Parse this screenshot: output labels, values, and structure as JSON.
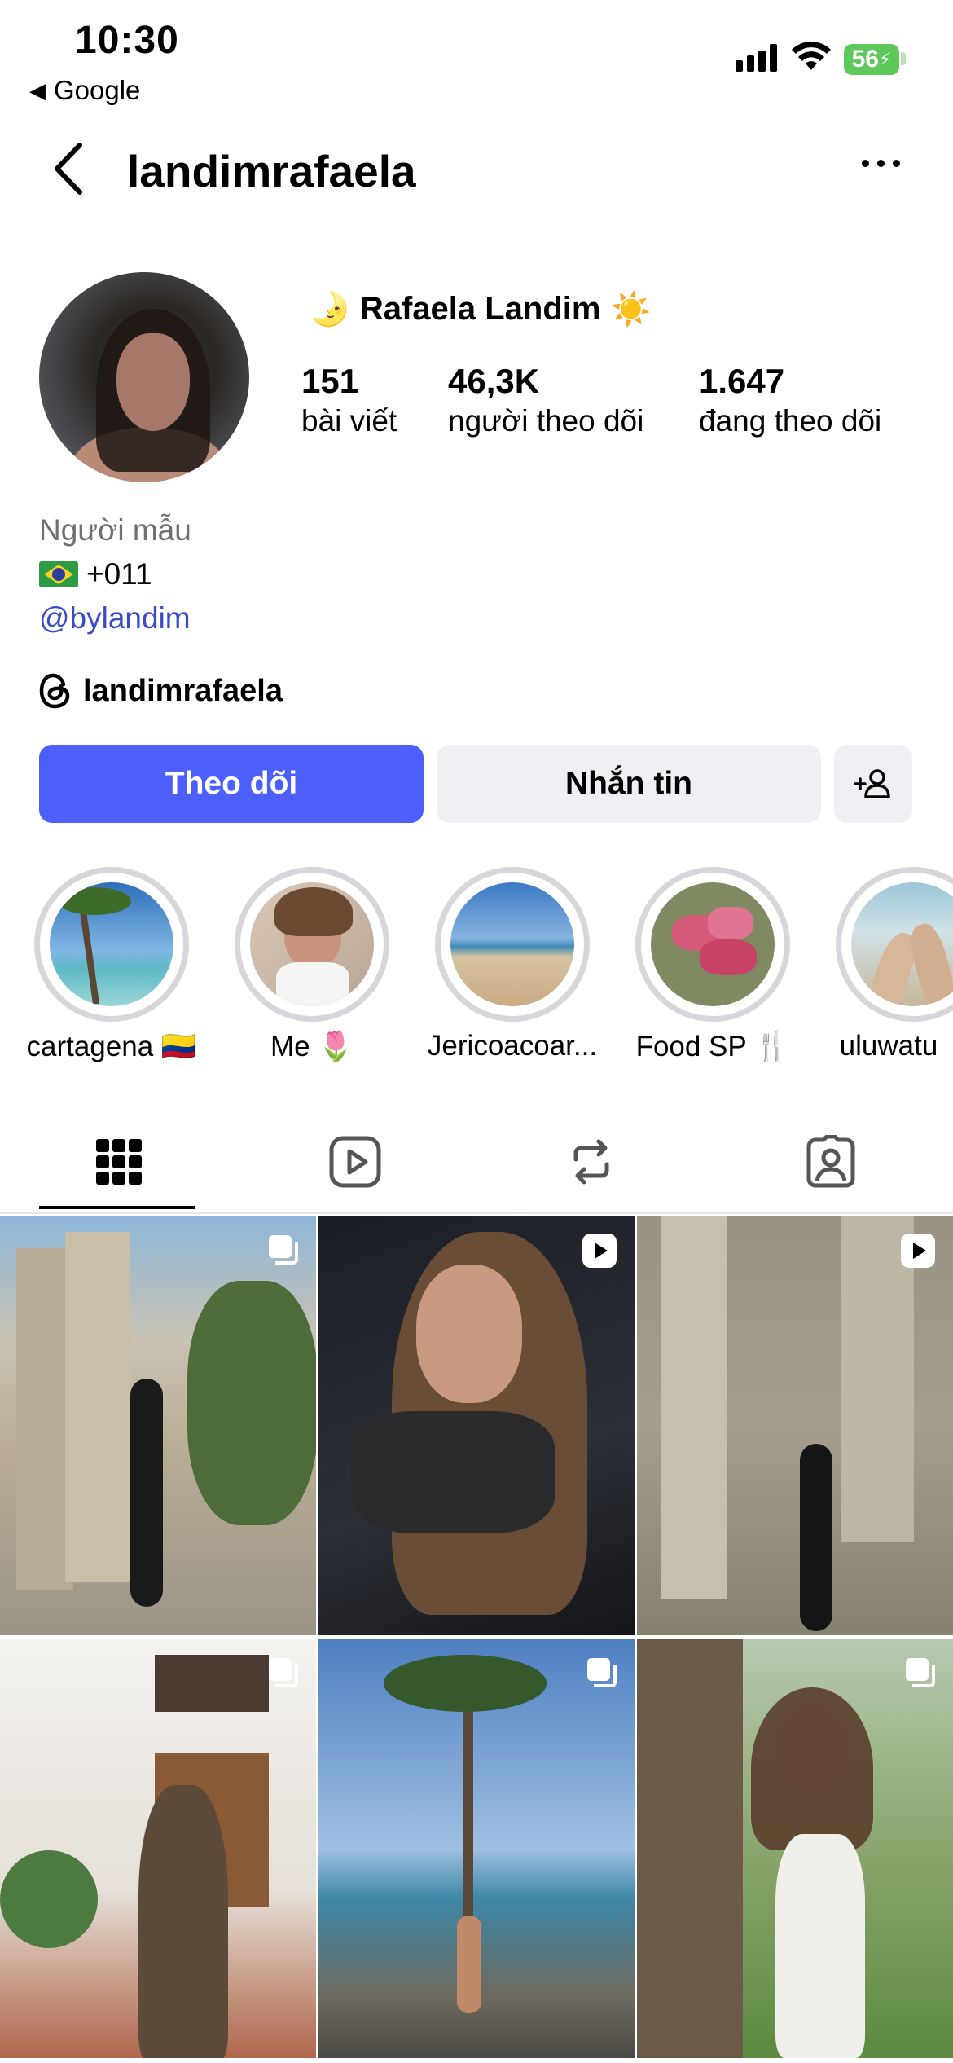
{
  "status_bar": {
    "time": "10:30",
    "back_app": "Google",
    "battery": "56"
  },
  "header": {
    "username": "landimrafaela"
  },
  "profile": {
    "display_name": "Rafaela Landim",
    "stats": [
      {
        "value": "151",
        "label": "bài viết"
      },
      {
        "value": "46,3K",
        "label": "người theo dõi"
      },
      {
        "value": "1.647",
        "label": "đang theo dõi"
      }
    ],
    "bio_category": "Người mẫu",
    "bio_phone": "+011",
    "bio_link": "@bylandim",
    "threads_handle": "landimrafaela"
  },
  "actions": {
    "follow": "Theo dõi",
    "message": "Nhắn tin"
  },
  "highlights": [
    {
      "label": "cartagena 🇨🇴"
    },
    {
      "label": "Me 🌷"
    },
    {
      "label": "Jericoacoar..."
    },
    {
      "label": "Food SP 🍴"
    },
    {
      "label": "uluwatu"
    }
  ],
  "tabs": [
    {
      "icon": "grid-icon",
      "active": true
    },
    {
      "icon": "reels-icon",
      "active": false
    },
    {
      "icon": "reposts-icon",
      "active": false
    },
    {
      "icon": "tagged-icon",
      "active": false
    }
  ],
  "posts": [
    {
      "type": "multi"
    },
    {
      "type": "reel"
    },
    {
      "type": "reel"
    },
    {
      "type": "multi"
    },
    {
      "type": "multi"
    },
    {
      "type": "multi"
    }
  ]
}
